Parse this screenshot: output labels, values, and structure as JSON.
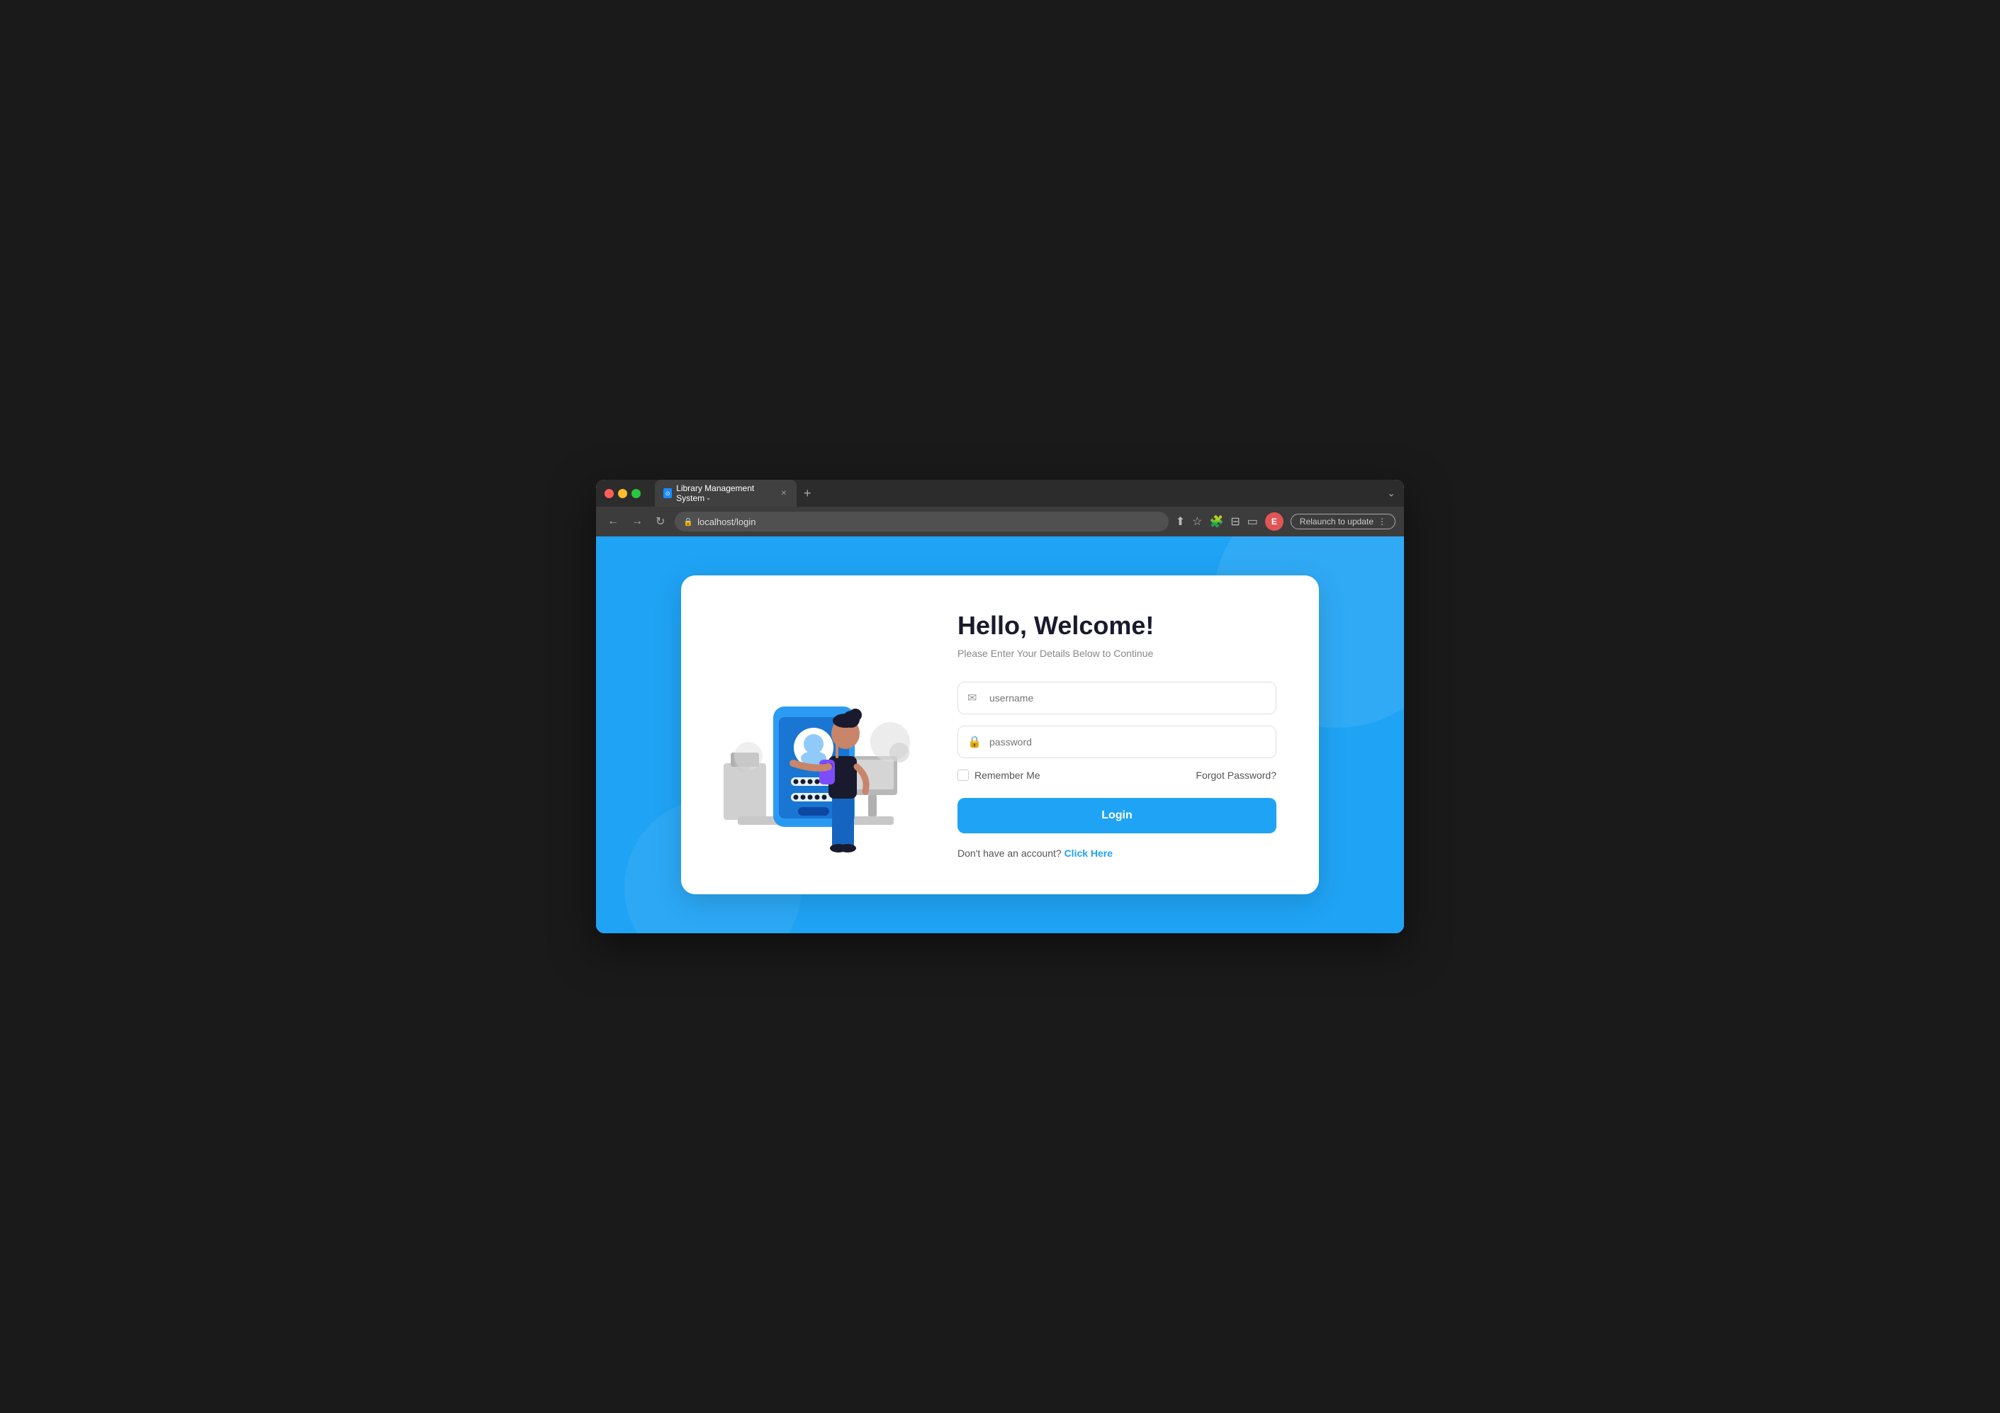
{
  "browser": {
    "title": "Library Management System -",
    "url": "localhost/login",
    "tab_label": "Library Management System -",
    "new_tab_label": "+",
    "nav": {
      "back": "←",
      "forward": "→",
      "refresh": "↻"
    },
    "toolbar_icons": [
      "share",
      "bookmark",
      "extensions",
      "sidebar",
      "display"
    ],
    "profile_letter": "E",
    "relaunch_label": "Relaunch to update"
  },
  "page": {
    "background_color": "#1fa3f5"
  },
  "login": {
    "title": "Hello,  Welcome!",
    "subtitle": "Please Enter Your Details Below to Continue",
    "username_placeholder": "username",
    "password_placeholder": "password",
    "remember_me_label": "Remember Me",
    "forgot_password_label": "Forgot Password?",
    "login_button_label": "Login",
    "signup_text": "Don't have an account?",
    "signup_link_label": "Click Here"
  }
}
